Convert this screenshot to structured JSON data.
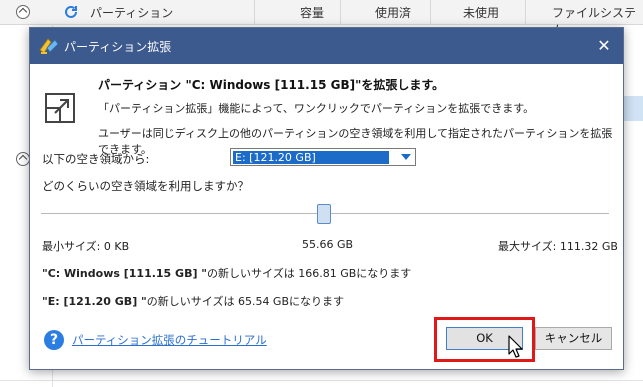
{
  "background": {
    "columns": {
      "partition": "パーティション",
      "capacity": "容量",
      "used": "使用済",
      "unused": "未使用",
      "filesystem": "ファイルシステム"
    }
  },
  "dialog": {
    "title": "パーティション拡張",
    "heading": "パーティション \"C: Windows [111.15 GB]\"を拡張します。",
    "desc1": "「パーティション拡張」機能によって、ワンクリックでパーティションを拡張できます。",
    "desc2": "ユーザーは同じディスク上の他のパーティションの空き領域を利用して指定されたパーティションを拡張できます。",
    "space_label": "以下の空き領域から:",
    "space_select_value": "E:  [121.20 GB]",
    "how_much_label": "どのくらいの空き領域を利用しますか？",
    "slider_fraction": 0.5,
    "min_size": "最小サイズ: 0 KB",
    "mid_size": "55.66 GB",
    "max_size": "最大サイズ: 111.32 GB",
    "new_c_name": "\"C: Windows [111.15 GB] \"",
    "new_c_rest": "の新しいサイズは 166.81 GBになります",
    "new_e_name": "\"E: [121.20 GB] \"",
    "new_e_rest": "の新しいサイズは 65.54 GBになります",
    "tutorial_link": "パーティション拡張のチュートリアル",
    "ok_label": "OK",
    "cancel_label": "キャンセル"
  },
  "icons": [
    "collapse-up-icon",
    "refresh-icon",
    "app-icon",
    "close-icon",
    "extend-partition-icon",
    "dropdown-arrow-icon",
    "help-icon",
    "mouse-cursor-icon"
  ],
  "colors": {
    "titlebar": "#3d5a8e",
    "selection": "#1c6bc8",
    "link": "#2b6fd0",
    "highlight_outline": "#e01818",
    "help": "#2b7de1"
  }
}
